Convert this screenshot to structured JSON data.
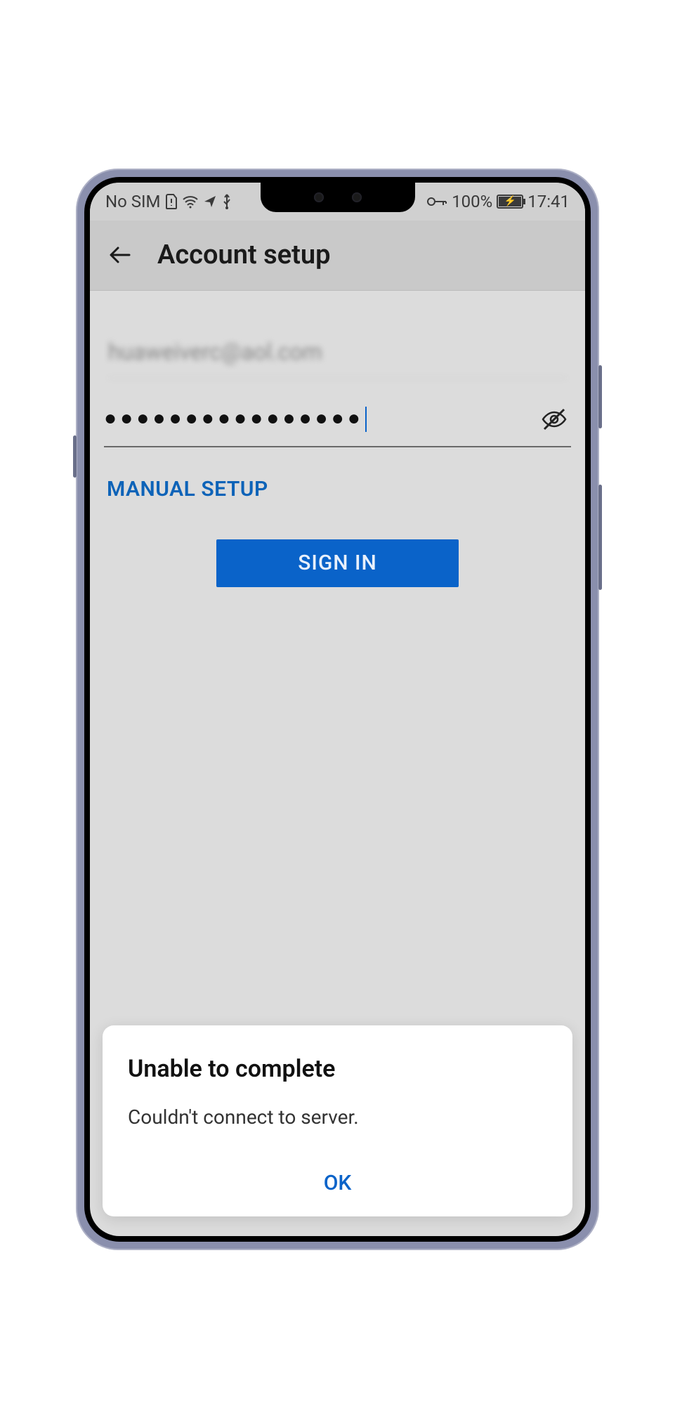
{
  "statusbar": {
    "sim_text": "No SIM",
    "battery_percent": "100%",
    "time": "17:41"
  },
  "appbar": {
    "title": "Account setup"
  },
  "form": {
    "email_value": "huaweiverc@aol.com",
    "password_masked": "●●●●●●●●●●●●●●●●",
    "manual_setup_label": "MANUAL SETUP",
    "signin_label": "SIGN IN"
  },
  "dialog": {
    "title": "Unable to complete",
    "message": "Couldn't connect to server.",
    "ok_label": "OK"
  }
}
